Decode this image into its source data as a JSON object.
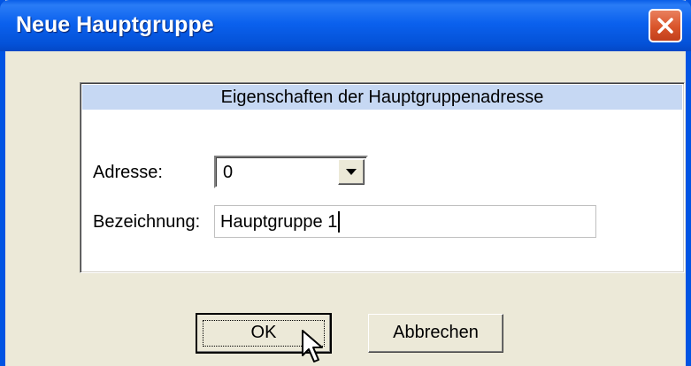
{
  "window": {
    "title": "Neue Hauptgruppe"
  },
  "panel": {
    "header": "Eigenschaften der Hauptgruppenadresse"
  },
  "form": {
    "address_label": "Adresse:",
    "address_value": "0",
    "name_label": "Bezeichnung:",
    "name_value": "Hauptgruppe 1"
  },
  "buttons": {
    "ok_label": "OK",
    "cancel_label": "Abbrechen"
  },
  "icons": {
    "close": "close-icon",
    "dropdown": "chevron-down-icon",
    "cursor": "mouse-pointer-icon"
  },
  "colors": {
    "titlebar": "#0054e3",
    "panel_header": "#c6d8f3",
    "close_button": "#d9542a",
    "dialog_bg": "#ece9d8"
  }
}
